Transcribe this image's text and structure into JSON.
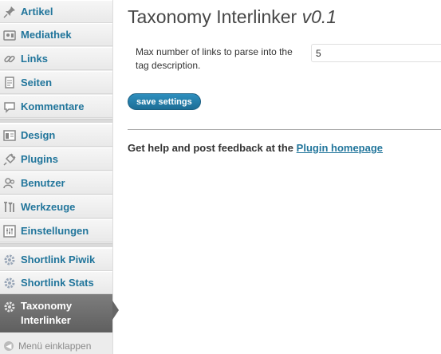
{
  "sidebar": {
    "items": [
      {
        "label": "Artikel",
        "icon": "pin-icon"
      },
      {
        "label": "Mediathek",
        "icon": "media-icon"
      },
      {
        "label": "Links",
        "icon": "links-icon"
      },
      {
        "label": "Seiten",
        "icon": "pages-icon"
      },
      {
        "label": "Kommentare",
        "icon": "comments-icon"
      },
      {
        "label": "Design",
        "icon": "appearance-icon"
      },
      {
        "label": "Plugins",
        "icon": "plugins-icon"
      },
      {
        "label": "Benutzer",
        "icon": "users-icon"
      },
      {
        "label": "Werkzeuge",
        "icon": "tools-icon"
      },
      {
        "label": "Einstellungen",
        "icon": "settings-icon"
      },
      {
        "label": "Shortlink Piwik",
        "icon": "gear-icon"
      },
      {
        "label": "Shortlink Stats",
        "icon": "gear-icon"
      }
    ],
    "active": {
      "line1": "Taxonomy",
      "line2": "Interlinker",
      "icon": "gear-icon"
    },
    "collapse_label": "Menü einklappen"
  },
  "page": {
    "title": "Taxonomy Interlinker",
    "version": "v0.1"
  },
  "form": {
    "field_label": "Max number of links to parse into the tag description.",
    "field_value": "5",
    "save_label": "save settings"
  },
  "help": {
    "text": "Get help and post feedback at the",
    "link": "Plugin homepage"
  },
  "colors": {
    "link": "#21759b",
    "active_bg": "#6d6d6d",
    "button": "#21759b"
  }
}
